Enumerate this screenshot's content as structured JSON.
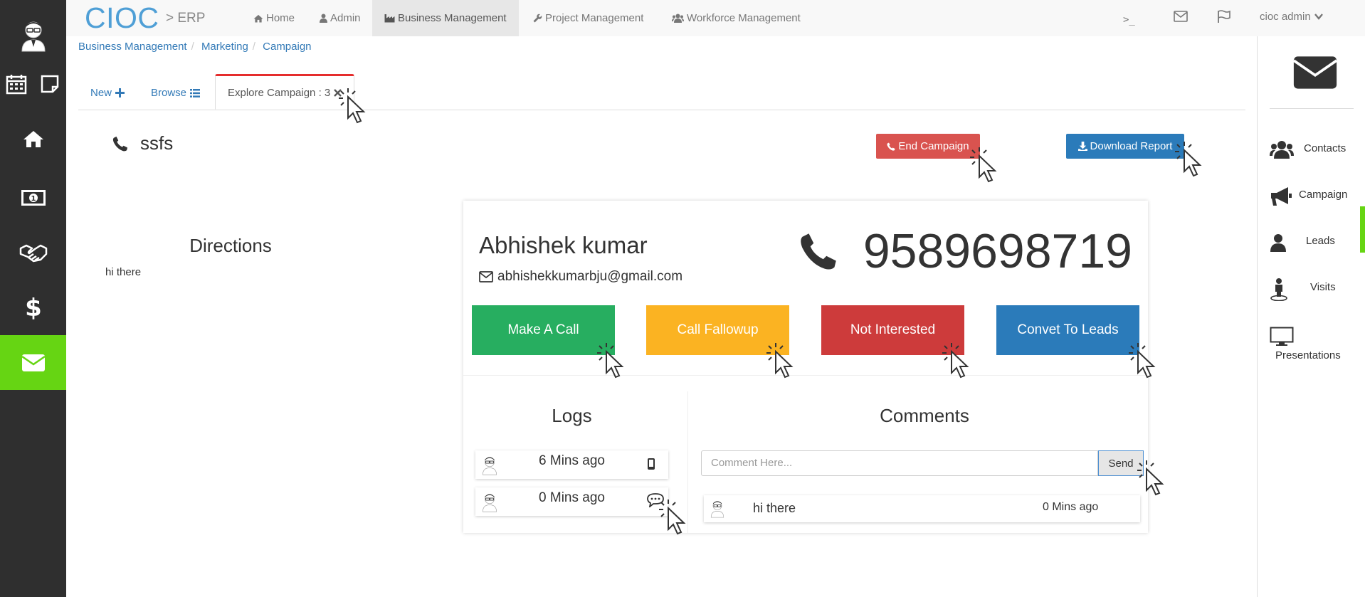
{
  "brand": {
    "name": "CIOC",
    "sub": "> ERP"
  },
  "topnav": {
    "items": [
      {
        "label": "Home",
        "icon": "home-icon"
      },
      {
        "label": "Admin",
        "icon": "user-icon"
      },
      {
        "label": "Business Management",
        "icon": "industry-icon"
      },
      {
        "label": "Project Management",
        "icon": "wrench-icon"
      },
      {
        "label": "Workforce Management",
        "icon": "users-icon"
      }
    ],
    "terminal": ">_",
    "user": "cioc admin"
  },
  "breadcrumb": [
    "Business Management",
    "Marketing",
    "Campaign"
  ],
  "tabs": {
    "new": "New",
    "browse": "Browse",
    "explore": "Explore Campaign : 3"
  },
  "campaign": {
    "name": "ssfs",
    "end_label": "End Campaign",
    "download_label": "Download Report"
  },
  "directions": {
    "title": "Directions",
    "text": "hi there"
  },
  "lead": {
    "name": "Abhishek kumar",
    "email": "abhishekkumarbju@gmail.com",
    "phone": "9589698719"
  },
  "actions": [
    {
      "label": "Make A Call",
      "color": "#27ae60"
    },
    {
      "label": "Call Fallowup",
      "color": "#fbb322"
    },
    {
      "label": "Not Interested",
      "color": "#cd3b3b"
    },
    {
      "label": "Convet To Leads",
      "color": "#2b7bba"
    }
  ],
  "logs": {
    "title": "Logs",
    "items": [
      {
        "when": "6 Mins ago",
        "icon": "mobile-icon"
      },
      {
        "when": "0 Mins ago",
        "icon": "chat-bubble-icon"
      }
    ]
  },
  "comments": {
    "title": "Comments",
    "placeholder": "Comment Here...",
    "send_label": "Send",
    "items": [
      {
        "text": "hi there",
        "when": "0 Mins ago"
      }
    ]
  },
  "rightbar": {
    "items": [
      "Contacts",
      "Campaign",
      "Leads",
      "Visits",
      "Presentations"
    ]
  },
  "colors": {
    "accent_green": "#66d513",
    "link_blue": "#337ab7",
    "danger_red": "#d9534f",
    "primary_blue": "#2b7bba"
  }
}
